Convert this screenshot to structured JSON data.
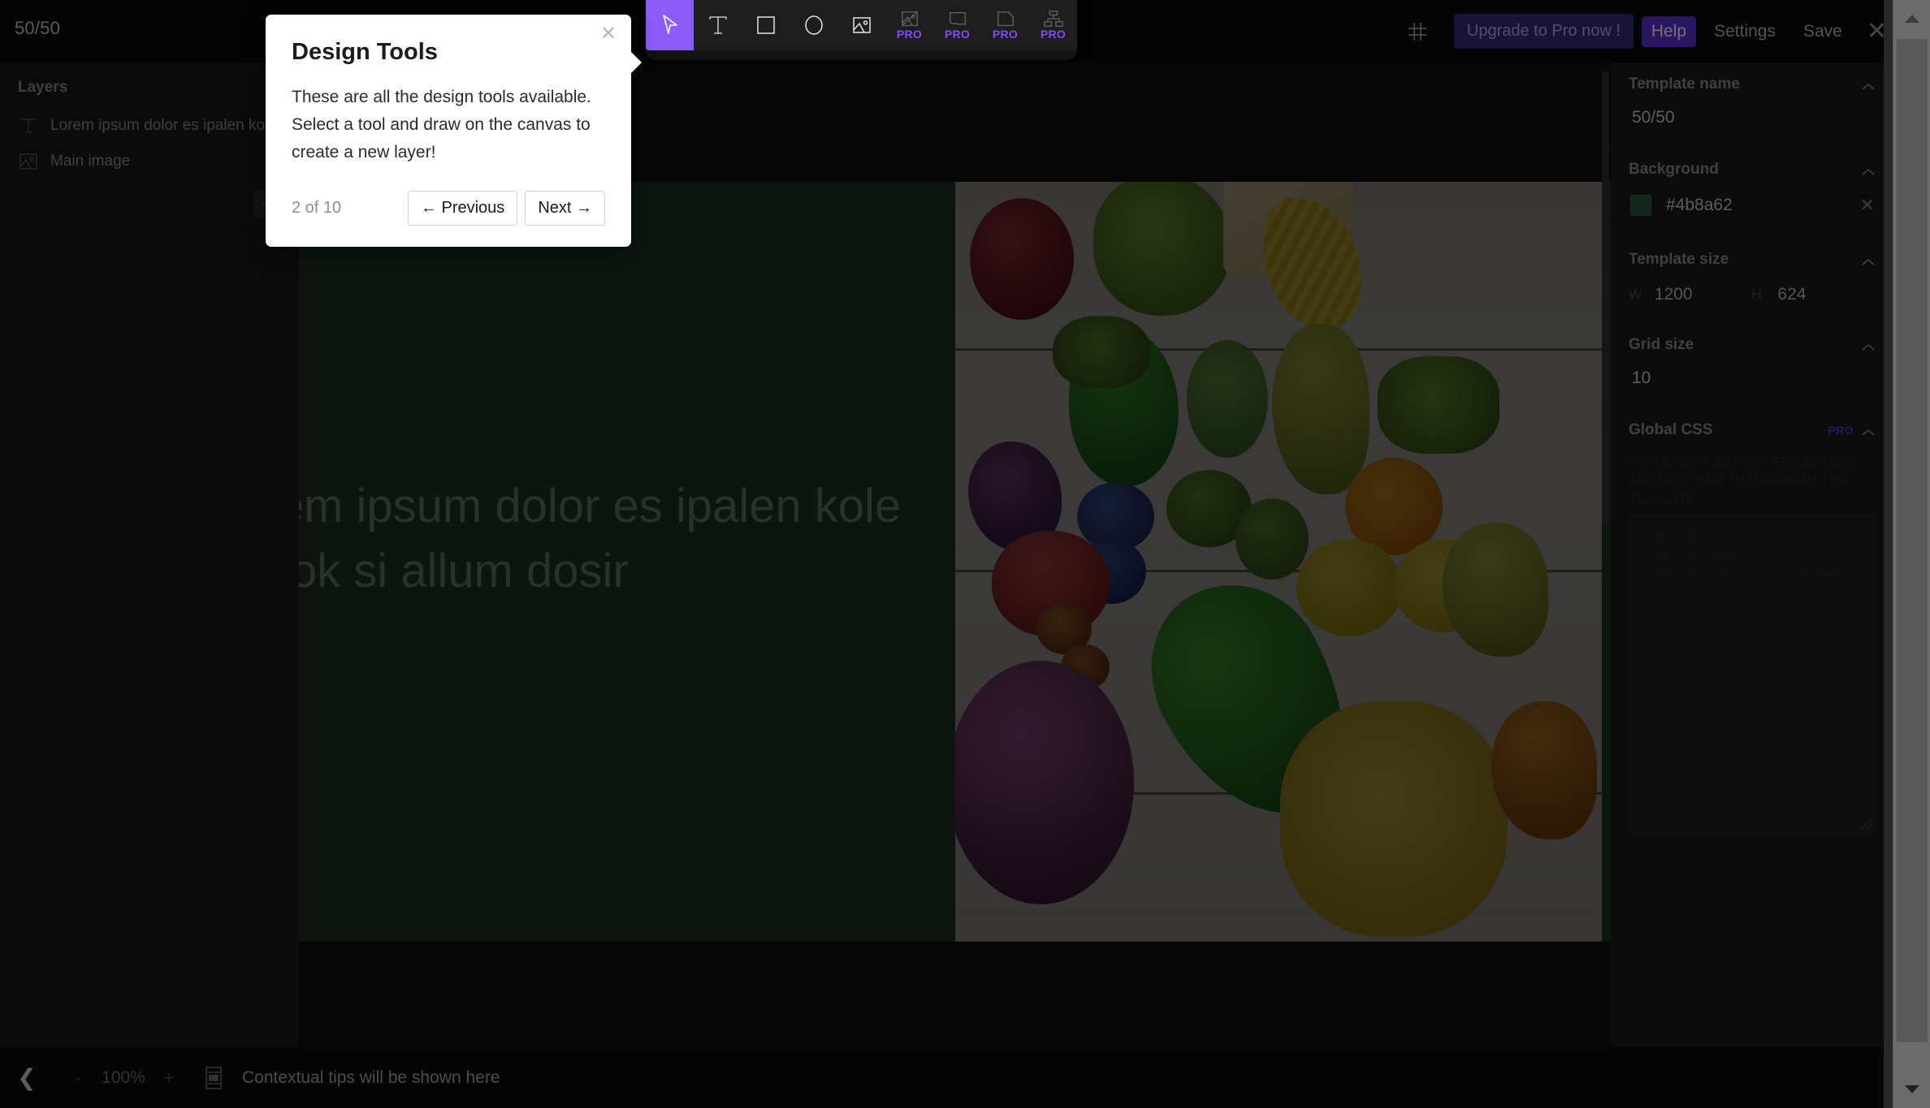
{
  "header": {
    "title": "50/50",
    "grid_icon": "grid-icon",
    "upgrade_label": "Upgrade to Pro now !",
    "help_label": "Help",
    "settings_label": "Settings",
    "save_label": "Save",
    "close_label": "✕"
  },
  "toolbar": {
    "tools": [
      {
        "name": "select-tool",
        "icon": "cursor-icon",
        "active": true,
        "pro": false,
        "pro_label": ""
      },
      {
        "name": "text-tool",
        "icon": "text-icon",
        "active": false,
        "pro": false,
        "pro_label": ""
      },
      {
        "name": "rect-tool",
        "icon": "square-icon",
        "active": false,
        "pro": false,
        "pro_label": ""
      },
      {
        "name": "ellipse-tool",
        "icon": "circle-icon",
        "active": false,
        "pro": false,
        "pro_label": ""
      },
      {
        "name": "image-tool",
        "icon": "image-icon",
        "active": false,
        "pro": false,
        "pro_label": ""
      },
      {
        "name": "mask-tool",
        "icon": "mask-icon",
        "active": false,
        "pro": true,
        "pro_label": "PRO"
      },
      {
        "name": "banner-tool",
        "icon": "banner-icon",
        "active": false,
        "pro": true,
        "pro_label": "PRO"
      },
      {
        "name": "shape-tool",
        "icon": "folded-icon",
        "active": false,
        "pro": true,
        "pro_label": "PRO"
      },
      {
        "name": "group-tool",
        "icon": "group-icon",
        "active": false,
        "pro": true,
        "pro_label": "PRO"
      }
    ]
  },
  "left_panel": {
    "title": "Layers",
    "layers": [
      {
        "icon": "text-layer-icon",
        "label": "Lorem ipsum dolor es ipalen kole"
      },
      {
        "icon": "image-layer-icon",
        "label": "Main image"
      }
    ],
    "add_label": "+"
  },
  "canvas": {
    "text": "Lorem ipsum dolor es ipalen kole marok si allum dosir",
    "background_color": "#1d3024",
    "photo_alt": "Main image"
  },
  "right_panel": {
    "sections": [
      {
        "title": "Template name",
        "pro": ""
      },
      {
        "title": "Background",
        "pro": ""
      },
      {
        "title": "Template size",
        "pro": ""
      },
      {
        "title": "Grid size",
        "pro": ""
      },
      {
        "title": "Global CSS",
        "pro": "PRO"
      }
    ],
    "template_name": "50/50",
    "background_hex": "#4b8a62",
    "background_swatch": "#4b8a62",
    "background_clear": "✕",
    "size_w_key": "W",
    "size_w_value": "1200",
    "size_h_key": "H",
    "size_h_value": "624",
    "grid_size": "10",
    "global_css_hint": "Write your custom styles here and use them throughout the template",
    "global_css_placeholder": ".my-class {\n  margin: 10px;\n  backdrop-filter: blur(10px);\n}"
  },
  "bottom_bar": {
    "back_icon": "chevron-left-icon",
    "zoom_out": "-",
    "zoom_value": "100%",
    "zoom_in": "+",
    "layout_icon": "layout-icon",
    "tip": "Contextual tips will be shown here"
  },
  "tour": {
    "title": "Design Tools",
    "body": "These are all the design tools available. Select a tool and draw on the canvas to create a new layer!",
    "counter": "2 of 10",
    "previous_label": "← Previous",
    "next_label": "Next →",
    "close_label": "✕"
  },
  "colors": {
    "accent_purple": "#5b2fd6",
    "tool_active": "#8b5cf6",
    "canvas_green": "#1d3024"
  }
}
